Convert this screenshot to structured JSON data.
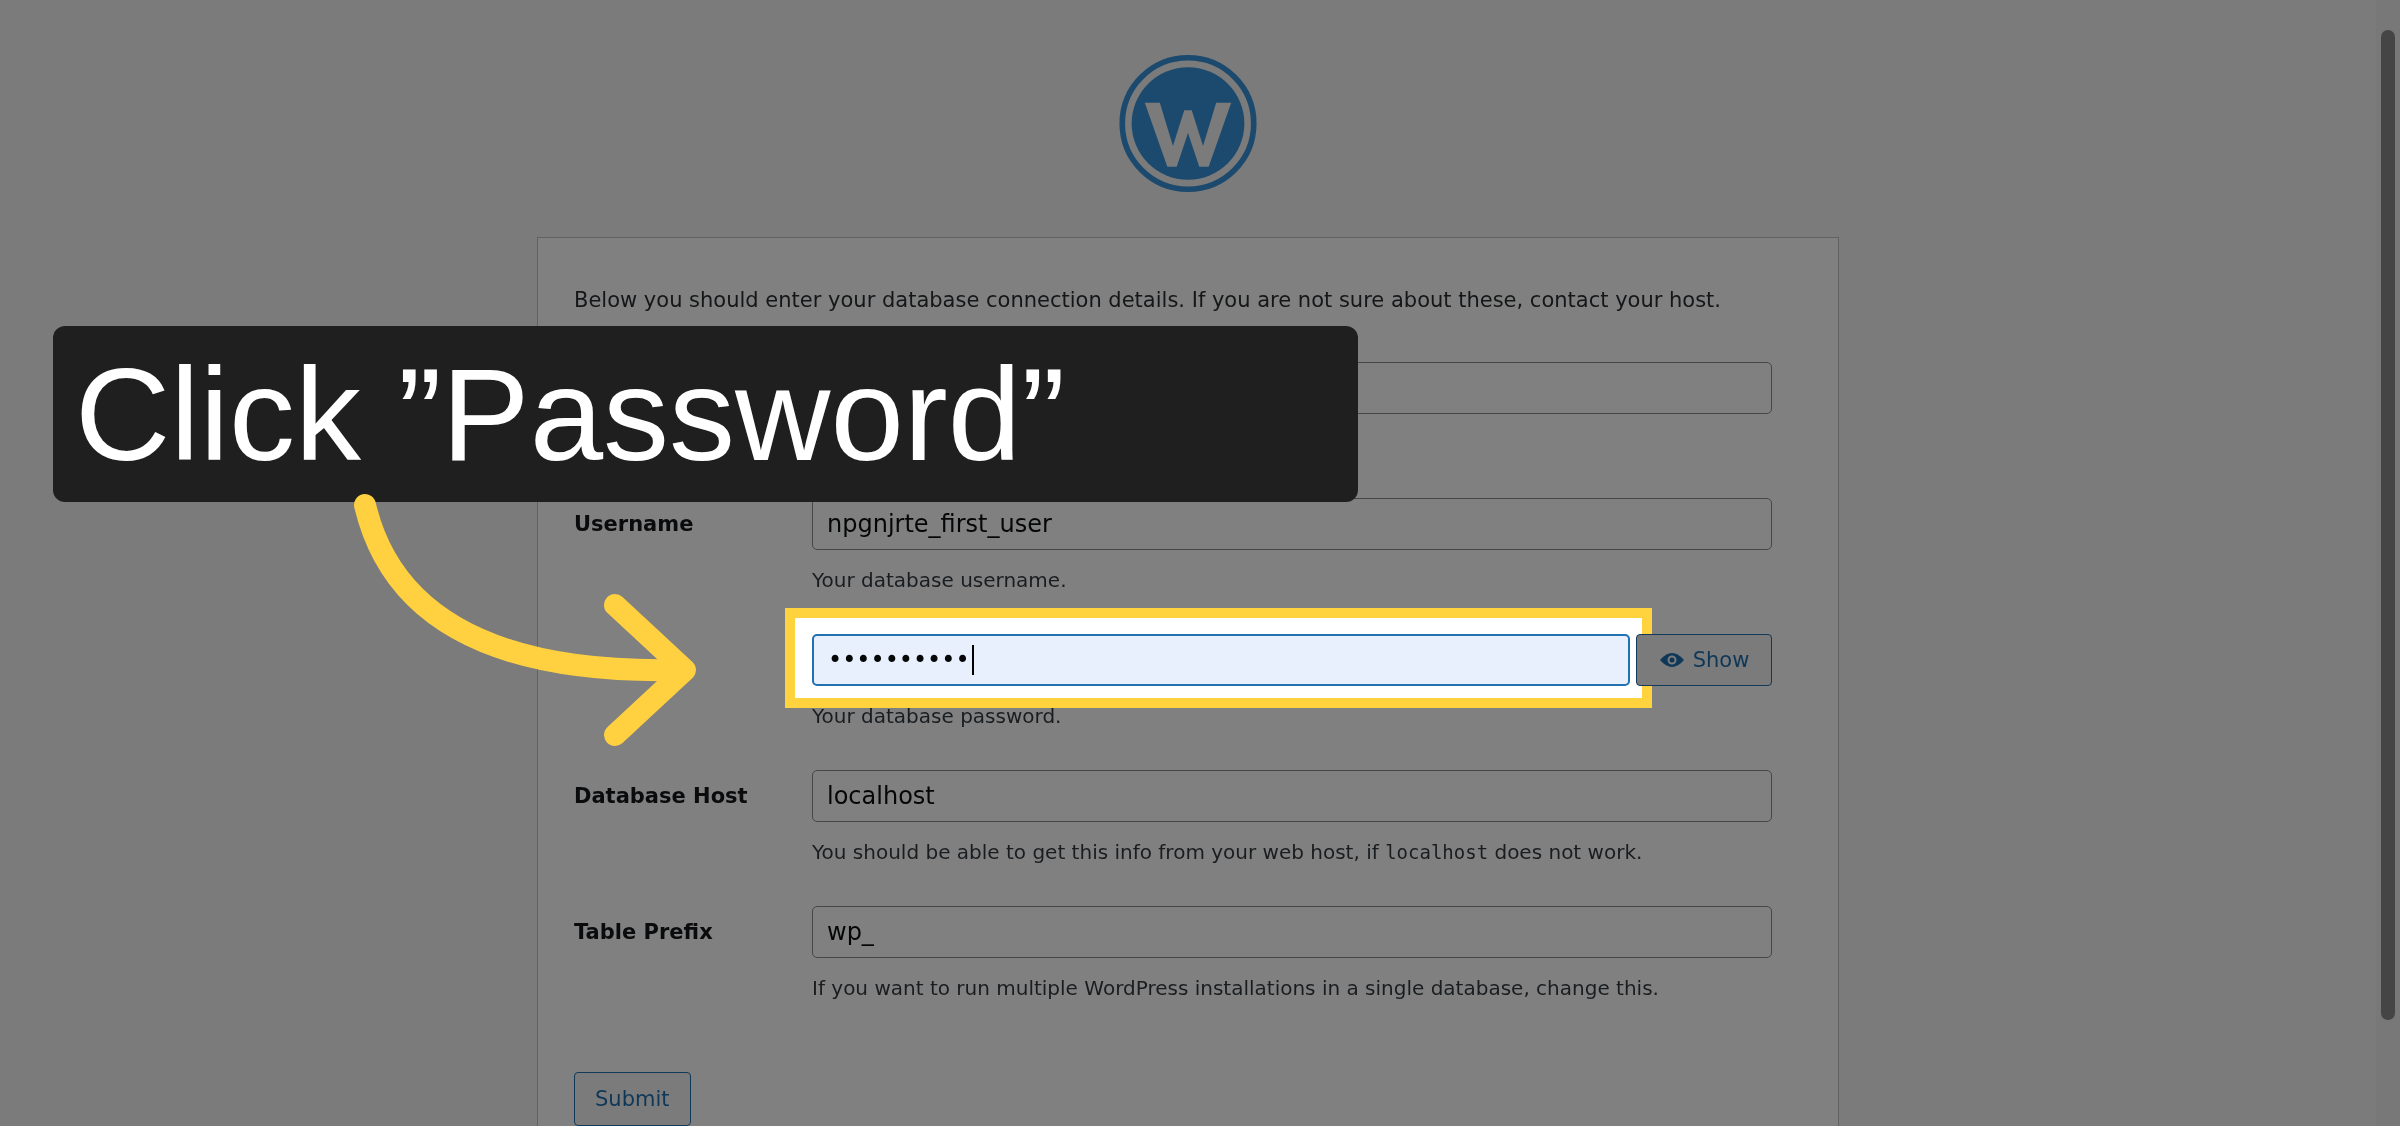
{
  "intro": "Below you should enter your database connection details. If you are not sure about these, contact your host.",
  "fields": [
    {
      "focused": false,
      "highlighted": false
    },
    {
      "label": "Username",
      "value": "npgnjrte_first_user",
      "focused": false,
      "highlighted": false,
      "help": [
        {
          "text": "Your database username.",
          "code": false
        }
      ]
    },
    {
      "value": "••••••••••",
      "focused": true,
      "highlighted": true,
      "show_button": "Show",
      "help": [
        {
          "text": "Your database password.",
          "code": false
        }
      ]
    },
    {
      "label": "Database Host",
      "value": "localhost",
      "focused": false,
      "highlighted": false,
      "help": [
        {
          "text": "You should be able to get this info from your web host, if ",
          "code": false
        },
        {
          "text": "localhost",
          "code": true
        },
        {
          "text": " does not work.",
          "code": false
        }
      ]
    },
    {
      "label": "Table Prefix",
      "value": "wp_",
      "focused": false,
      "highlighted": false,
      "help": [
        {
          "text": "If you want to run multiple WordPress installations in a single database, change this.",
          "code": false
        }
      ]
    }
  ],
  "submit": "Submit",
  "callout": {
    "text": "Click ”Password”"
  }
}
